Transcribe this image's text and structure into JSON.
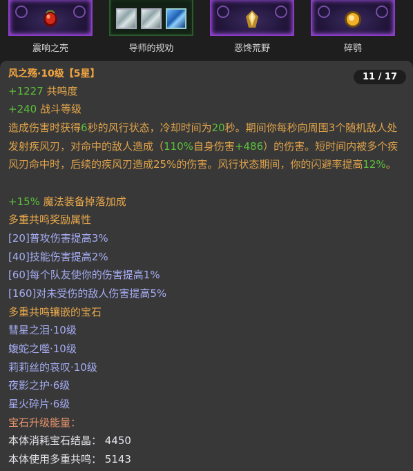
{
  "top_gems": [
    {
      "label": "震响之壳",
      "icon": "red-gem-icon"
    },
    {
      "label": "导师的规劝",
      "icon": "triple-gem-icon"
    },
    {
      "label": "恶馋荒野",
      "icon": "gold-crystal-icon"
    },
    {
      "label": "碎鹗",
      "icon": "amber-gem-icon"
    }
  ],
  "pager": "11 / 17",
  "item": {
    "title": "风之殇·10级【5星】",
    "stat1_value": "+1227",
    "stat1_label": "共鸣度",
    "stat2_value": "+240",
    "stat2_label": "战斗等级",
    "desc": {
      "p1": "造成伤害时获得",
      "n1": "6",
      "p2": "秒的风行状态，冷却时间为",
      "n2": "20",
      "p3": "秒。期间你每秒向周围3个随机敌人处发射疾风刃，对命中的敌人造成（",
      "n3": "110%",
      "p4": "自身伤害",
      "n4": "+486",
      "p5": "）的伤害。短时间内被多个疾风刃命中时，后续的疾风刃造成25%的伤害。风行状态期间，你的闪避率提高",
      "n5": "12%",
      "p6": "。"
    },
    "bonus_value": "+15%",
    "bonus_label": "魔法装备掉落加成",
    "resonance_title": "多重共鸣奖励属性",
    "resonance": [
      "[20]普攻伤害提高3%",
      "[40]技能伤害提高2%",
      "[60]每个队友使你的伤害提高1%",
      "[160]对未受伤的敌人伤害提高5%"
    ],
    "inlaid_title": "多重共鸣镶嵌的宝石",
    "inlaid": [
      "彗星之泪·10级",
      "蝮蛇之噬·10级",
      "莉莉丝的哀叹·10级",
      "夜影之护·6级",
      "星火碎片·6级"
    ],
    "upgrade_title": "宝石升级能量：",
    "upgrade": [
      {
        "label": "本体消耗宝石结晶：",
        "value": "4450"
      },
      {
        "label": "本体使用多重共鸣：",
        "value": "5143"
      }
    ]
  },
  "colors": {
    "title": "#f3a640",
    "positive": "#5cc03a",
    "description": "#e0a34a",
    "resonance": "#a6adf4",
    "panel_bg": "#383838",
    "gem_frame": "#8a3cc8"
  }
}
